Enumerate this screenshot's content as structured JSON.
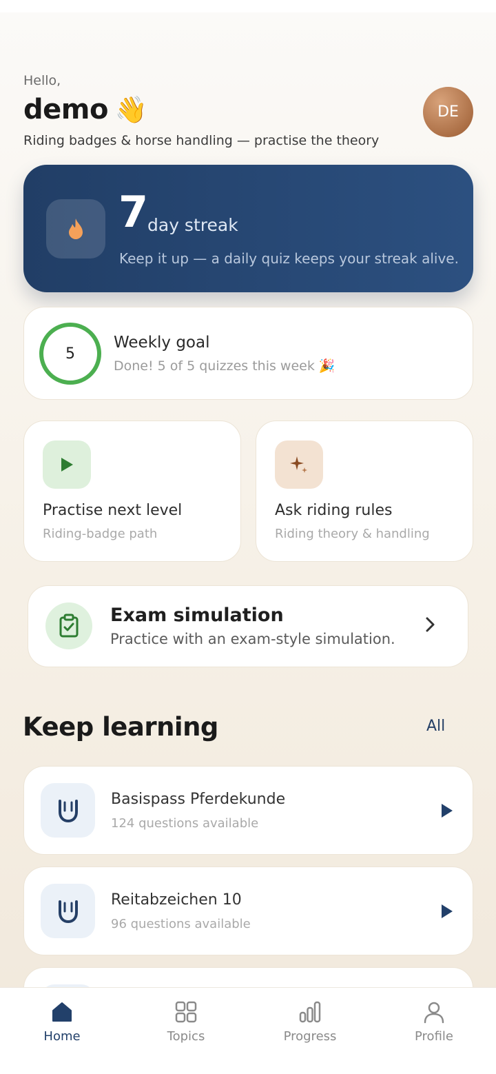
{
  "header": {
    "greeting": "Hello,",
    "name": "demo",
    "emoji": "👋",
    "subtitle": "Riding badges & horse handling — practise the theory",
    "avatar_initials": "DE"
  },
  "streak": {
    "count": "7",
    "label": "day streak",
    "message": "Keep it up — a daily quiz keeps your streak alive.",
    "icon": "flame-icon"
  },
  "weekly_goal": {
    "count": "5",
    "title": "Weekly goal",
    "status": "Done! 5 of 5 quizzes this week 🎉",
    "progress_fraction": 1.0
  },
  "tiles": [
    {
      "title": "Practise next level",
      "subtitle": "Riding-badge path",
      "icon": "play-icon"
    },
    {
      "title": "Ask riding rules",
      "subtitle": "Riding theory & handling",
      "icon": "sparkle-icon"
    }
  ],
  "exam": {
    "title": "Exam simulation",
    "subtitle": "Practice with an exam-style simulation.",
    "icon": "clipboard-check-icon"
  },
  "keep_learning": {
    "title": "Keep learning",
    "all_label": "All",
    "courses": [
      {
        "title": "Basispass Pferdekunde",
        "subtitle": "124 questions available"
      },
      {
        "title": "Reitabzeichen 10",
        "subtitle": "96 questions available"
      },
      {
        "title": "",
        "subtitle": ""
      }
    ]
  },
  "nav": {
    "items": [
      {
        "label": "Home",
        "icon": "home-icon",
        "active": true
      },
      {
        "label": "Topics",
        "icon": "grid-icon",
        "active": false
      },
      {
        "label": "Progress",
        "icon": "bar-chart-icon",
        "active": false
      },
      {
        "label": "Profile",
        "icon": "user-icon",
        "active": false
      }
    ]
  },
  "colors": {
    "navy": "#22406a",
    "green": "#4caf50",
    "brown": "#a0623a",
    "background": "#f6f0e6"
  }
}
